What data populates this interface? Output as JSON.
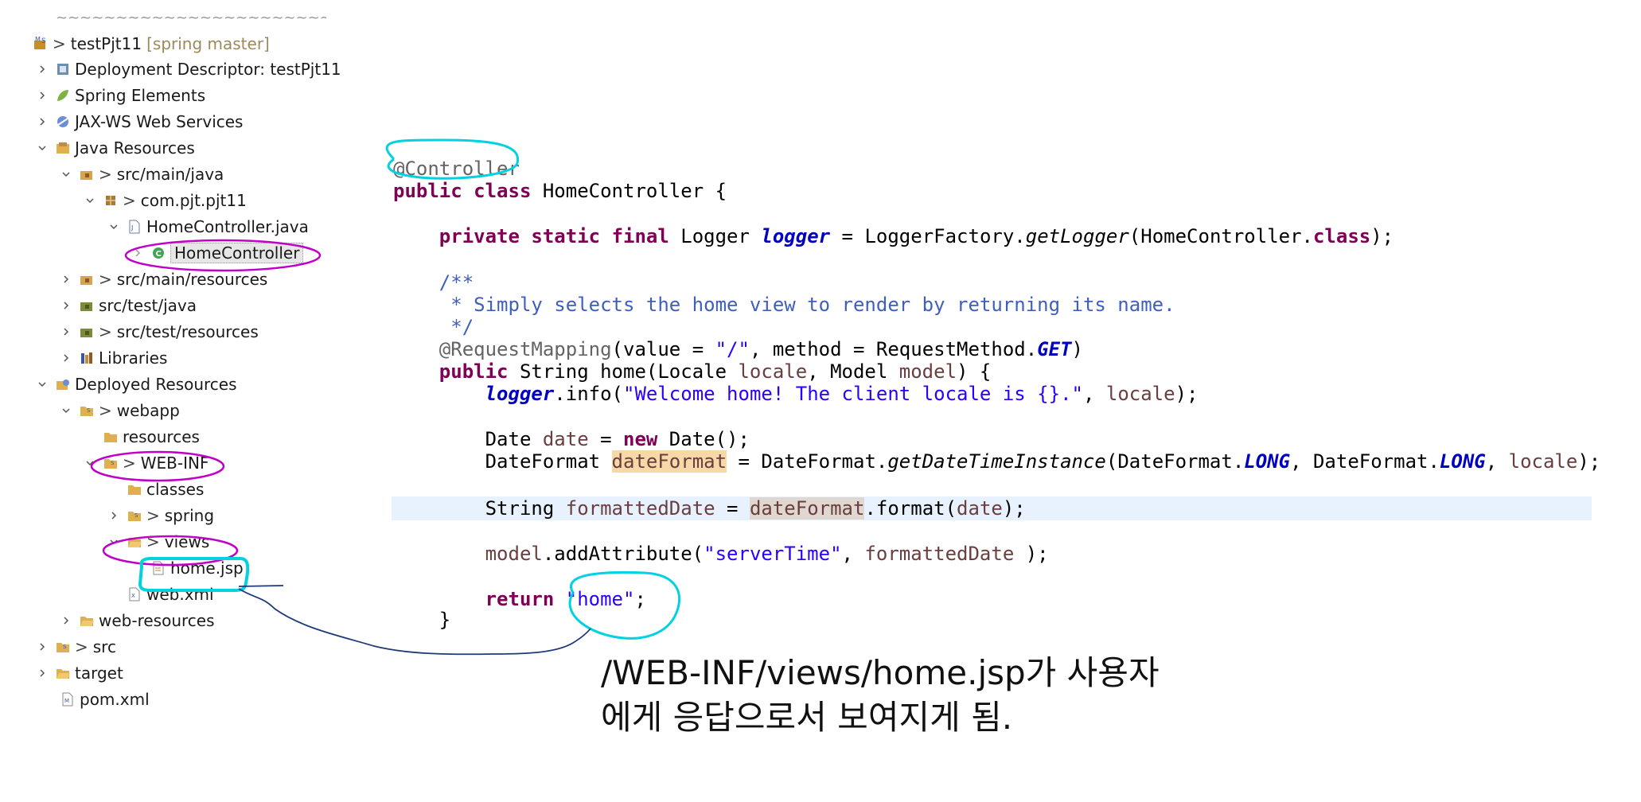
{
  "explorer": {
    "project": {
      "name": "testPjt11",
      "decoration": "[spring master]"
    },
    "items": [
      {
        "label": "Deployment Descriptor: testPjt11"
      },
      {
        "label": "Spring Elements"
      },
      {
        "label": "JAX-WS Web Services"
      },
      {
        "label": "Java Resources"
      },
      {
        "label": "src/main/java"
      },
      {
        "label": "com.pjt.pjt11"
      },
      {
        "label": "HomeController.java"
      },
      {
        "label": "HomeController"
      },
      {
        "label": "src/main/resources"
      },
      {
        "label": "src/test/java"
      },
      {
        "label": "src/test/resources"
      },
      {
        "label": "Libraries"
      },
      {
        "label": "Deployed Resources"
      },
      {
        "label": "webapp"
      },
      {
        "label": "resources"
      },
      {
        "label": "WEB-INF"
      },
      {
        "label": "classes"
      },
      {
        "label": "spring"
      },
      {
        "label": "views"
      },
      {
        "label": "home.jsp"
      },
      {
        "label": "web.xml"
      },
      {
        "label": "web-resources"
      },
      {
        "label": "src"
      },
      {
        "label": "target"
      },
      {
        "label": "pom.xml"
      }
    ]
  },
  "code": {
    "annotation_controller": "@Controller",
    "kw_public": "public",
    "kw_class": "class",
    "class_name": " HomeController {",
    "kw_private": "private",
    "kw_static": "static",
    "kw_final": "final",
    "logger_type": " Logger ",
    "logger_field": "logger",
    "logger_assign": " = LoggerFactory.",
    "get_logger": "getLogger",
    "logger_args": "(HomeController.",
    "logger_end": ");",
    "comment_open": "/**",
    "comment_body": " * Simply selects the home view to render by returning its name.",
    "comment_close": " */",
    "request_mapping": "@RequestMapping",
    "rm_value": "(value = ",
    "rm_path": "\"/\"",
    "rm_method": ", method = RequestMethod.",
    "rm_get": "GET",
    "rm_end": ")",
    "home_sig_a": " String home(Locale ",
    "p_locale": "locale",
    "home_sig_b": ", Model ",
    "p_model": "model",
    "home_sig_c": ") {",
    "info_call": ".info(",
    "welcome_str": "\"Welcome home! The client locale is {}.\"",
    "comma_sp": ", ",
    "close_paren_semi": ");",
    "date_type": "Date ",
    "v_date": "date",
    "eq_sp": " = ",
    "kw_new": "new",
    "date_ctor": " Date();",
    "dateformat_type": "DateFormat ",
    "v_dateformat": "dateFormat",
    "dt_call_a": " = DateFormat.",
    "dt_method": "getDateTimeInstance",
    "dt_call_b": "(DateFormat.",
    "c_long": "LONG",
    "dt_sep": ", DateFormat.",
    "string_type": "String ",
    "v_formatted": "formattedDate",
    "fmt_call_b": ".format(",
    "add_attr": ".addAttribute(",
    "server_time": "\"serverTime\"",
    "attr_end": " );",
    "kw_return": "return",
    "home_str": "\"home\"",
    "semi": ";",
    "close_brace": "}"
  },
  "note": {
    "line1": "/WEB-INF/views/home.jsp가 사용자",
    "line2": "에게 응답으로서 보여지게 됨."
  },
  "colors": {
    "highlight_cyan": "#00d2e0",
    "highlight_magenta": "#c000c8",
    "arrow_navy": "#1f3a78",
    "keyword": "#7f0055",
    "string": "#2a00ff",
    "comment": "#3f5fbf",
    "field": "#0000c0"
  }
}
